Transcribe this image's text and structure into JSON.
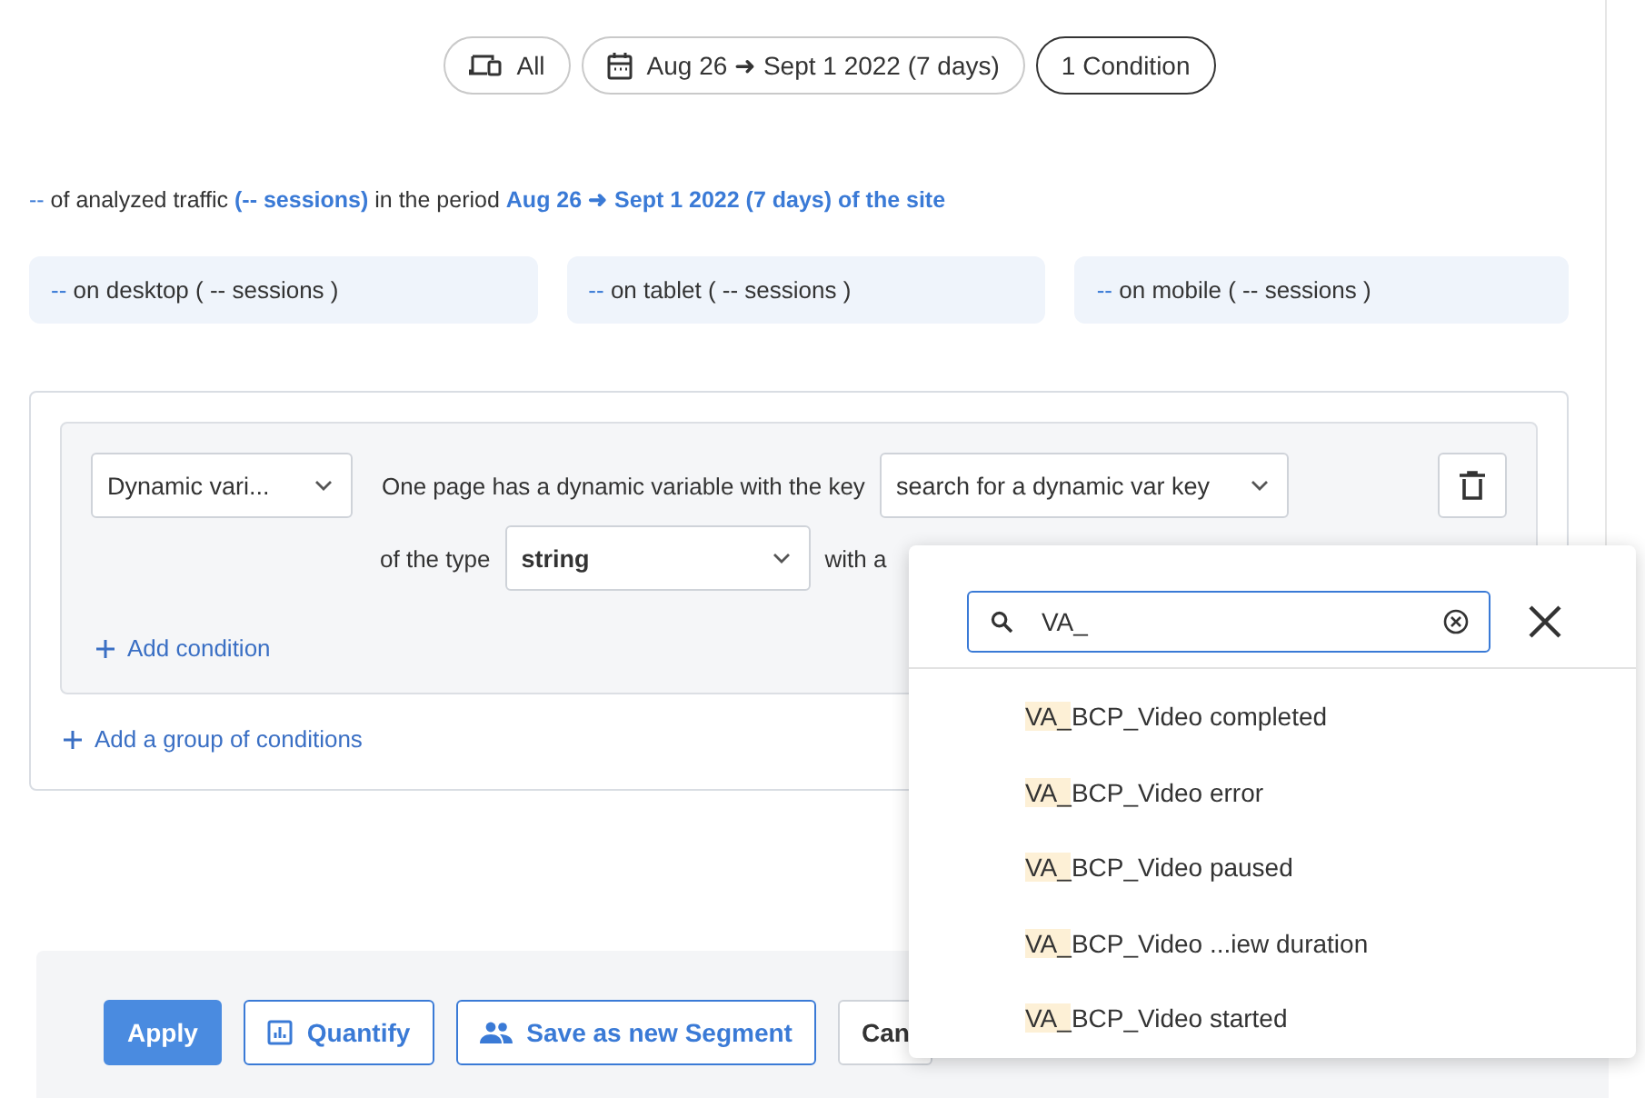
{
  "filters": [
    {
      "kind": "device",
      "label": "All",
      "selected": false
    },
    {
      "kind": "date",
      "label": "Aug 26 ➜ Sept 1 2022 (7 days)",
      "selected": false
    },
    {
      "kind": "conditions",
      "label": "1 Condition",
      "selected": true
    }
  ],
  "summary": [
    {
      "text": "--",
      "kind": "value"
    },
    {
      "text": " of analyzed traffic ",
      "kind": "plain"
    },
    {
      "text": "(-- sessions)",
      "kind": "strong"
    },
    {
      "text": " in the period ",
      "kind": "plain"
    },
    {
      "text": "Aug 26 ➜ Sept 1 2022 (7 days) of the site",
      "kind": "strong"
    }
  ],
  "devices": [
    {
      "value": "--",
      "label": "on desktop ( -- sessions )"
    },
    {
      "value": "--",
      "label": "on tablet ( -- sessions )"
    },
    {
      "value": "--",
      "label": "on mobile ( -- sessions )"
    }
  ],
  "condition": {
    "type_select": "Dynamic vari...",
    "key_text": "One page has a dynamic variable with the key",
    "key_select": "search for a dynamic var key",
    "type_label": "of the type",
    "value_type": "string",
    "with_text": "with a",
    "add_condition": "Add condition"
  },
  "add_group": "Add a group of conditions",
  "footer": {
    "buttons": [
      {
        "kind": "primary",
        "label": "Apply"
      },
      {
        "kind": "quantify",
        "label": "Quantify"
      },
      {
        "kind": "segment",
        "label": "Save as new Segment"
      },
      {
        "kind": "plain",
        "label": "Can"
      }
    ]
  },
  "popup": {
    "search_value": "VA_",
    "options": [
      {
        "match": "VA_",
        "rest": "BCP_Video completed"
      },
      {
        "match": "VA_",
        "rest": "BCP_Video error"
      },
      {
        "match": "VA_",
        "rest": "BCP_Video paused"
      },
      {
        "match": "VA_",
        "rest": "BCP_Video ...iew duration"
      },
      {
        "match": "VA_",
        "rest": "BCP_Video started"
      }
    ]
  }
}
